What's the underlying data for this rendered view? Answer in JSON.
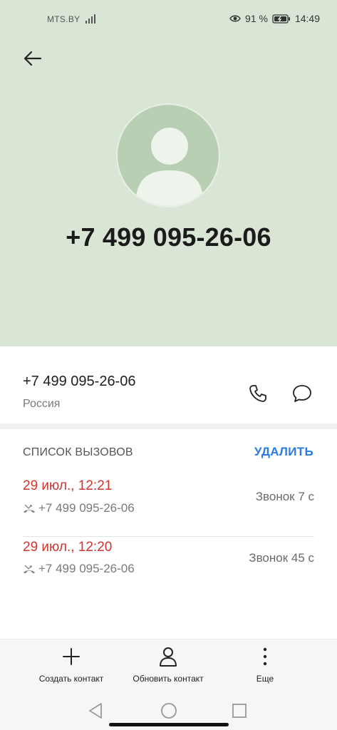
{
  "status_bar": {
    "carrier": "MTS.BY",
    "battery_percent": "91 %",
    "time": "14:49",
    "icons": [
      "signal-icon",
      "eye-icon",
      "battery-icon"
    ]
  },
  "header": {
    "phone_number": "+7 499 095-26-06",
    "background_color": "#d9e6d5",
    "avatar_icon": "person-avatar-icon"
  },
  "contact": {
    "number": "+7 499 095-26-06",
    "country": "Россия",
    "actions": [
      "phone-icon",
      "message-icon"
    ]
  },
  "call_log": {
    "title": "СПИСОК ВЫЗОВОВ",
    "delete_label": "УДАЛИТЬ",
    "accent_color": "#2c7be0",
    "missed_color": "#d0342c",
    "entries": [
      {
        "date": "29 июл., 12:21",
        "number": "+7 499 095-26-06",
        "duration": "Звонок 7 с"
      },
      {
        "date": "29 июл., 12:20",
        "number": "+7 499 095-26-06",
        "duration": "Звонок 45 с"
      }
    ]
  },
  "bottom_actions": {
    "create_contact": "Создать контакт",
    "update_contact": "Обновить контакт",
    "more": "Еще"
  }
}
